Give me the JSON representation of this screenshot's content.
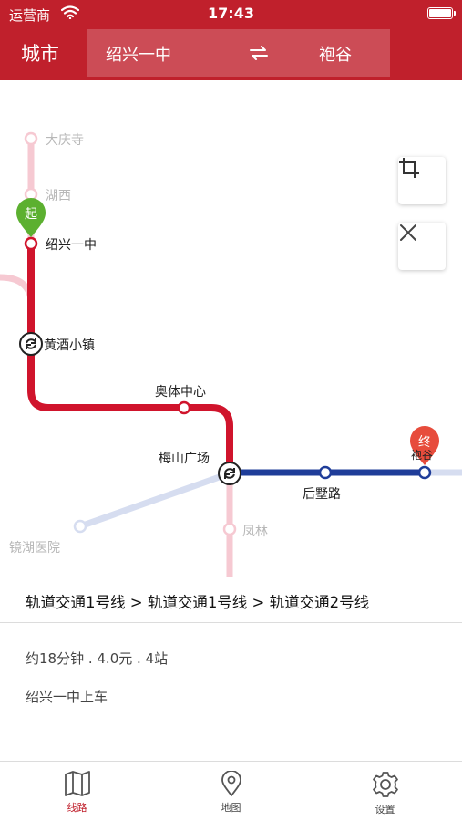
{
  "status_bar": {
    "carrier": "运营商",
    "time": "17:43"
  },
  "header": {
    "city_label": "城市",
    "from_station": "绍兴一中",
    "to_station": "袍谷"
  },
  "map": {
    "start_marker": "起",
    "end_marker": "终",
    "stations": {
      "daqingsi": "大庆寺",
      "huxi": "湖西",
      "shaoxing_yizhong": "绍兴一中",
      "huangjiu_xiaozhen": "黄酒小镇",
      "aoti_zhongxin": "奥体中心",
      "meishan_guangchang": "梅山广场",
      "houshu_lu": "后墅路",
      "paogu": "袍谷",
      "fenglin": "凤林",
      "jinghu_yiyuan": "镜湖医院"
    },
    "colors": {
      "line1": "#d0142c",
      "line1_faded": "#f6c9d2",
      "line2": "#1f3d99",
      "line2_faded": "#d6ddf0",
      "start_pin": "#5cb030",
      "end_pin": "#e74c3c"
    }
  },
  "route": {
    "lines": "轨道交通1号线 > 轨道交通1号线 > 轨道交通2号线",
    "summary": "约18分钟 . 4.0元 . 4站",
    "boarding": "绍兴一中上车"
  },
  "tabs": [
    {
      "label": "线路",
      "icon": "map-book-icon",
      "active": true
    },
    {
      "label": "地图",
      "icon": "location-pin-icon",
      "active": false
    },
    {
      "label": "设置",
      "icon": "gear-icon",
      "active": false
    }
  ]
}
